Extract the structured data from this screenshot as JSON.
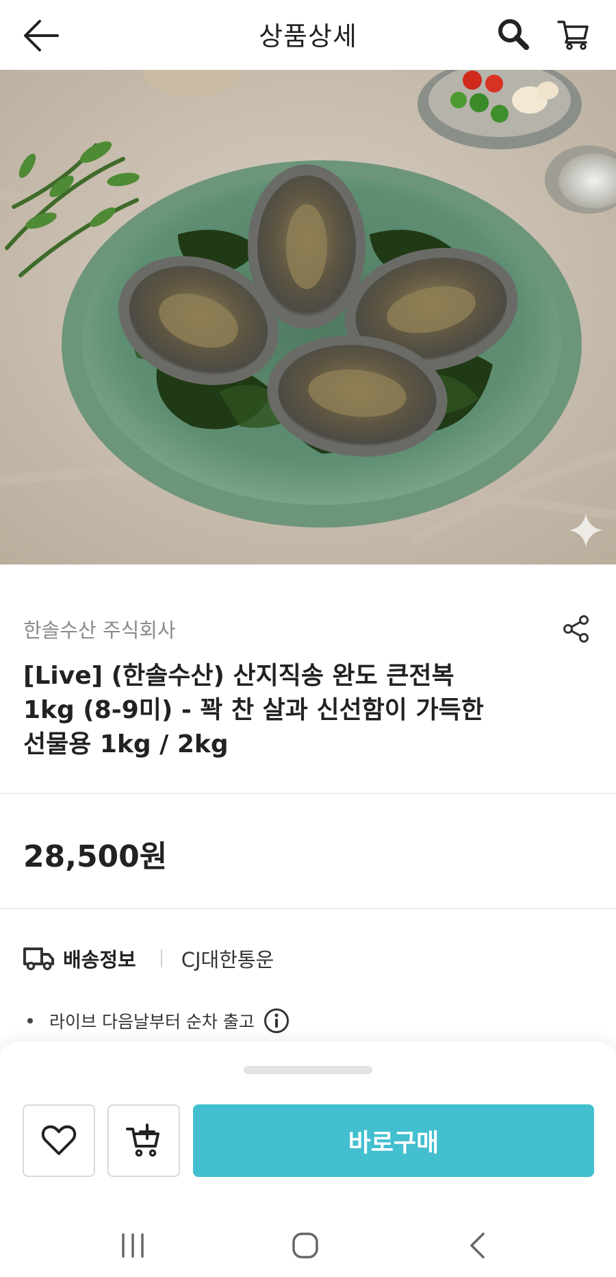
{
  "header": {
    "title": "상품상세",
    "back_icon": "arrow-left-icon",
    "search_icon": "search-icon",
    "cart_icon": "cart-icon"
  },
  "hero": {
    "image_subject": "abalone-on-seaweed-plate",
    "sparkle_icon": "sparkle-icon"
  },
  "product": {
    "seller": "한솔수산 주식회사",
    "title_lines": [
      "[Live] (한솔수산) 산지직송 완도 큰전복",
      "1kg (8-9미) - 꽉 찬 살과 신선함이 가득한",
      "선물용 1kg / 2kg"
    ],
    "price": "28,500원",
    "share_icon": "share-icon"
  },
  "delivery": {
    "icon": "truck-icon",
    "label": "배송정보",
    "carrier": "CJ대한통운",
    "notice": "라이브 다음날부터 순차 출고",
    "info_icon": "info-icon"
  },
  "bottom_bar": {
    "wish_icon": "heart-icon",
    "add_cart_icon": "cart-plus-icon",
    "buy_label": "바로구매",
    "buy_color": "#43bfcf"
  },
  "system_nav": {
    "recent_icon": "recent-apps-icon",
    "home_icon": "home-icon",
    "back_icon": "chevron-left-icon"
  }
}
